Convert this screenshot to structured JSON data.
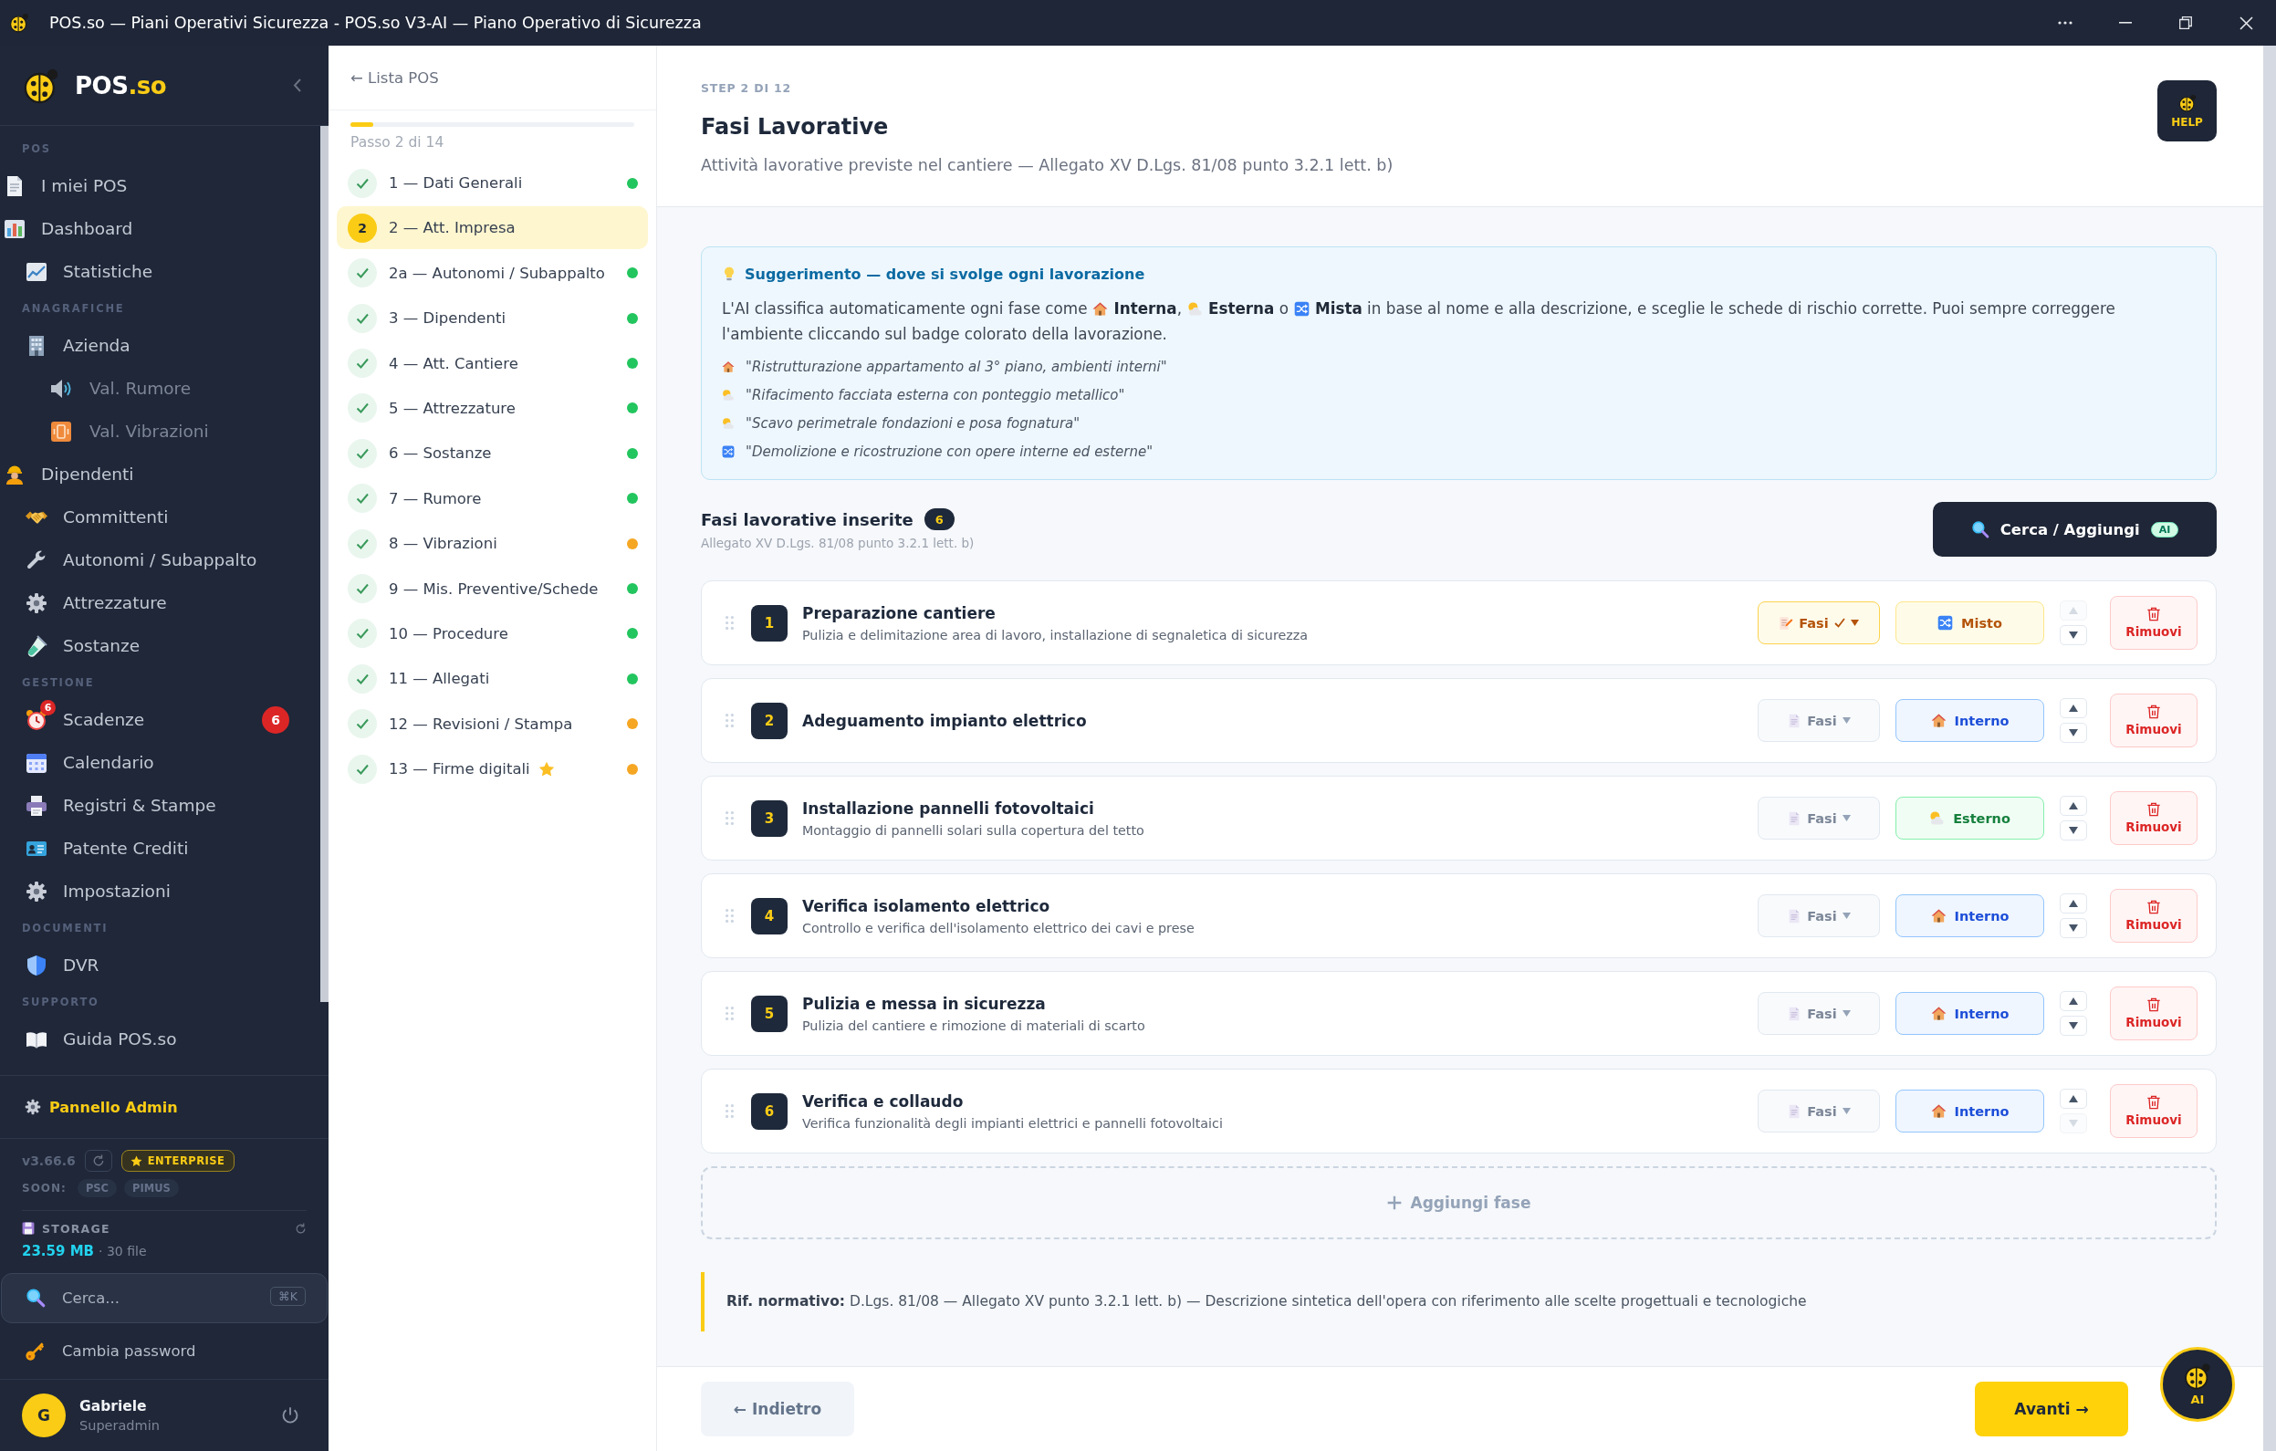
{
  "window": {
    "title": "POS.so — Piani Operativi Sicurezza - POS.so V3-AI — Piano Operativo di Sicurezza"
  },
  "sidebar": {
    "logo": {
      "name": "POS",
      "suffix": ".so"
    },
    "sections": [
      {
        "label": "POS",
        "items": [
          {
            "label": "I miei POS",
            "kind": "primary"
          },
          {
            "label": "Dashboard",
            "kind": "primary"
          },
          {
            "label": "Statistiche",
            "kind": "secondary"
          }
        ]
      },
      {
        "label": "ANAGRAFICHE",
        "items": [
          {
            "label": "Azienda",
            "kind": "secondary",
            "children": [
              {
                "label": "Val. Rumore"
              },
              {
                "label": "Val. Vibrazioni"
              }
            ]
          },
          {
            "label": "Dipendenti",
            "kind": "primary"
          },
          {
            "label": "Committenti",
            "kind": "secondary"
          },
          {
            "label": "Autonomi / Subappalto",
            "kind": "secondary"
          },
          {
            "label": "Attrezzature",
            "kind": "secondary"
          },
          {
            "label": "Sostanze",
            "kind": "secondary"
          }
        ]
      },
      {
        "label": "GESTIONE",
        "items": [
          {
            "label": "Scadenze",
            "kind": "secondary",
            "icon_badge": "6",
            "badge": "6"
          },
          {
            "label": "Calendario",
            "kind": "secondary"
          },
          {
            "label": "Registri & Stampe",
            "kind": "secondary"
          },
          {
            "label": "Patente Crediti",
            "kind": "secondary"
          },
          {
            "label": "Impostazioni",
            "kind": "secondary"
          }
        ]
      },
      {
        "label": "DOCUMENTI",
        "items": [
          {
            "label": "DVR",
            "kind": "secondary"
          }
        ]
      },
      {
        "label": "SUPPORTO",
        "items": [
          {
            "label": "Guida POS.so",
            "kind": "secondary"
          }
        ]
      }
    ],
    "admin_link": "Pannello Admin",
    "version": "v3.66.6",
    "plan": "ENTERPRISE",
    "soon": {
      "label": "SOON:",
      "items": [
        "PSC",
        "PIMUS"
      ]
    },
    "storage": {
      "label": "STORAGE",
      "used": "23.59 MB",
      "files": "· 30 file"
    },
    "search": {
      "placeholder": "Cerca...",
      "shortcut": "⌘K"
    },
    "change_password": "Cambia password",
    "user": {
      "initial": "G",
      "name": "Gabriele",
      "role": "Superadmin"
    }
  },
  "steps_panel": {
    "back_link": "← Lista POS",
    "progress": {
      "level": 0.08,
      "label": "Passo 2 di 14"
    },
    "steps": [
      {
        "label": "1 — Dati Generali",
        "done": true,
        "selected": false,
        "starred": false,
        "color": "#22c55e"
      },
      {
        "number": "2",
        "label": "2 — Att. Impresa",
        "done": false,
        "selected": true,
        "starred": false
      },
      {
        "label": "2a — Autonomi / Subappalto",
        "done": true,
        "selected": false,
        "starred": false,
        "color": "#22c55e"
      },
      {
        "label": "3 — Dipendenti",
        "done": true,
        "selected": false,
        "starred": false,
        "color": "#22c55e"
      },
      {
        "label": "4 — Att. Cantiere",
        "done": true,
        "selected": false,
        "starred": false,
        "color": "#22c55e"
      },
      {
        "label": "5 — Attrezzature",
        "done": true,
        "selected": false,
        "starred": false,
        "color": "#22c55e"
      },
      {
        "label": "6 — Sostanze",
        "done": true,
        "selected": false,
        "starred": false,
        "color": "#22c55e"
      },
      {
        "label": "7 — Rumore",
        "done": true,
        "selected": false,
        "starred": false,
        "color": "#22c55e"
      },
      {
        "label": "8 — Vibrazioni",
        "done": true,
        "selected": false,
        "starred": false,
        "color": "#f5a623"
      },
      {
        "label": "9 — Mis. Preventive/Schede",
        "done": true,
        "selected": false,
        "starred": false,
        "color": "#22c55e"
      },
      {
        "label": "10 — Procedure",
        "done": true,
        "selected": false,
        "starred": false,
        "color": "#22c55e"
      },
      {
        "label": "11 — Allegati",
        "done": true,
        "selected": false,
        "starred": false,
        "color": "#22c55e"
      },
      {
        "label": "12 — Revisioni / Stampa",
        "done": true,
        "selected": false,
        "starred": false,
        "color": "#f5a623"
      },
      {
        "label": "13 — Firme digitali",
        "done": true,
        "selected": false,
        "starred": true,
        "color": "#f5a623"
      }
    ]
  },
  "header": {
    "step": "STEP 2 DI 12",
    "title": "Fasi Lavorative",
    "subtitle": "Attività lavorative previste nel cantiere — Allegato XV D.Lgs. 81/08 punto 3.2.1 lett. b)",
    "help_button": "HELP"
  },
  "tip": {
    "title": "Suggerimento — dove si svolge ogni lavorazione",
    "body": [
      {
        "kind": "plain",
        "text": "L'AI classifica automaticamente ogni fase come"
      },
      {
        "kind": "interno",
        "text": "**Interna**,"
      },
      {
        "kind": "esterno",
        "text": "**Esterna** o"
      },
      {
        "kind": "misto",
        "text": "**Mista** in base al nome e alla descrizione, e sceglie le schede di rischio corrette. Puoi sempre correggere l'ambiente cliccando sul badge colorato della lavorazione."
      }
    ],
    "examples": [
      {
        "kind": "interno",
        "text": "\"Ristrutturazione appartamento al 3° piano, ambienti interni\""
      },
      {
        "kind": "esterno",
        "text": "\"Rifacimento facciata esterna con ponteggio metallico\""
      },
      {
        "kind": "esterno",
        "text": "\"Scavo perimetrale fondazioni e posa fognatura\""
      },
      {
        "kind": "misto",
        "text": "\"Demolizione e ricostruzione con opere interne ed esterne\""
      }
    ]
  },
  "phases_section": {
    "title": "Fasi lavorative inserite",
    "count": "6",
    "subtitle": "Allegato XV D.Lgs. 81/08 punto 3.2.1 lett. b)",
    "search_button": "Cerca / Aggiungi",
    "search_badge": "AI",
    "phases": [
      {
        "number": "1",
        "title": "Preparazione cantiere",
        "description": "Pulizia e delimitazione area di lavoro, installazione di segnaletica di sicurezza",
        "fasi": {
          "label": "Fasi",
          "configured": true
        },
        "environment": {
          "kind": "misto",
          "label": "Misto"
        },
        "move_up": {
          "disabled": true
        },
        "move_down": {
          "disabled": false
        },
        "remove": "Rimuovi"
      },
      {
        "number": "2",
        "title": "Adeguamento impianto elettrico",
        "fasi": {
          "label": "Fasi",
          "configured": false
        },
        "environment": {
          "kind": "interno",
          "label": "Interno"
        },
        "move_up": {
          "disabled": false
        },
        "move_down": {
          "disabled": false
        },
        "remove": "Rimuovi"
      },
      {
        "number": "3",
        "title": "Installazione pannelli fotovoltaici",
        "description": "Montaggio di pannelli solari sulla copertura del tetto",
        "fasi": {
          "label": "Fasi",
          "configured": false
        },
        "environment": {
          "kind": "esterno",
          "label": "Esterno"
        },
        "move_up": {
          "disabled": false
        },
        "move_down": {
          "disabled": false
        },
        "remove": "Rimuovi"
      },
      {
        "number": "4",
        "title": "Verifica isolamento elettrico",
        "description": "Controllo e verifica dell'isolamento elettrico dei cavi e prese",
        "fasi": {
          "label": "Fasi",
          "configured": false
        },
        "environment": {
          "kind": "interno",
          "label": "Interno"
        },
        "move_up": {
          "disabled": false
        },
        "move_down": {
          "disabled": false
        },
        "remove": "Rimuovi"
      },
      {
        "number": "5",
        "title": "Pulizia e messa in sicurezza",
        "description": "Pulizia del cantiere e rimozione di materiali di scarto",
        "fasi": {
          "label": "Fasi",
          "configured": false
        },
        "environment": {
          "kind": "interno",
          "label": "Interno"
        },
        "move_up": {
          "disabled": false
        },
        "move_down": {
          "disabled": false
        },
        "remove": "Rimuovi"
      },
      {
        "number": "6",
        "title": "Verifica e collaudo",
        "description": "Verifica funzionalità degli impianti elettrici e pannelli fotovoltaici",
        "fasi": {
          "label": "Fasi",
          "configured": false
        },
        "environment": {
          "kind": "interno",
          "label": "Interno"
        },
        "move_up": {
          "disabled": false
        },
        "move_down": {
          "disabled": true
        },
        "remove": "Rimuovi"
      }
    ],
    "add_button": "Aggiungi fase"
  },
  "reference": "**Rif. normativo:** D.Lgs. 81/08 — Allegato XV punto 3.2.1 lett. b) — Descrizione sintetica dell'opera con riferimento alle scelte progettuali e tecnologiche",
  "footer": {
    "back_button": "← Indietro",
    "next_button": "Avanti →",
    "ai_button": "AI"
  }
}
